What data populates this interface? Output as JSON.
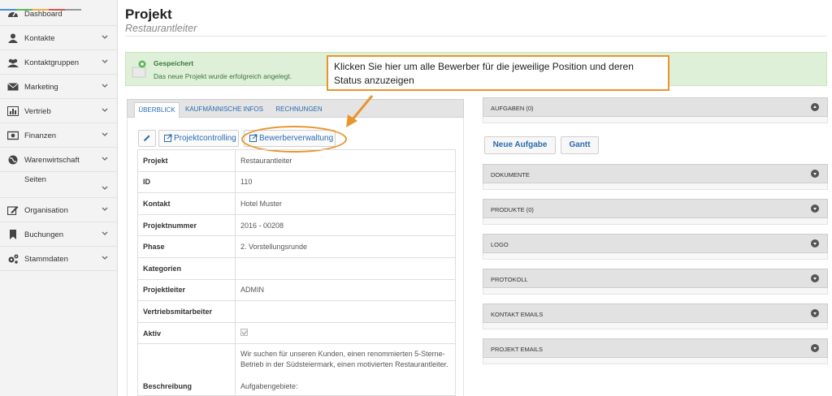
{
  "sidebar": {
    "items": [
      {
        "label": "Dashboard",
        "icon": "dashboard-icon",
        "has_chevron": false
      },
      {
        "label": "Kontakte",
        "icon": "user-icon",
        "has_chevron": true
      },
      {
        "label": "Kontaktgruppen",
        "icon": "users-icon",
        "has_chevron": true
      },
      {
        "label": "Marketing",
        "icon": "envelope-icon",
        "has_chevron": true
      },
      {
        "label": "Vertrieb",
        "icon": "bar-chart-icon",
        "has_chevron": true
      },
      {
        "label": "Finanzen",
        "icon": "money-icon",
        "has_chevron": true
      },
      {
        "label": "Warenwirtschaft",
        "icon": "globe-icon",
        "has_chevron": true
      },
      {
        "label": "Seiten",
        "icon": "",
        "has_chevron": true
      },
      {
        "label": "Organisation",
        "icon": "edit-icon",
        "has_chevron": true
      },
      {
        "label": "Buchungen",
        "icon": "bookmark-icon",
        "has_chevron": true
      },
      {
        "label": "Stammdaten",
        "icon": "cogs-icon",
        "has_chevron": true
      }
    ]
  },
  "header": {
    "title": "Projekt",
    "subtitle": "Restaurantleiter"
  },
  "alert": {
    "title": "Gespeichert",
    "message": "Das neue Projekt wurde erfolgreich angelegt."
  },
  "callout": {
    "text": "Klicken Sie hier um alle Bewerber für die jeweilige Position und deren Status anzuzeigen"
  },
  "tabs": [
    {
      "label": "ÜBERBLICK",
      "active": true
    },
    {
      "label": "KAUFMÄNNISCHE INFOS",
      "active": false
    },
    {
      "label": "RECHNUNGEN",
      "active": false
    }
  ],
  "toolbar": {
    "edit_icon": "pencil-icon",
    "projektcontrolling_label": "Projektcontrolling",
    "bewerberverwaltung_label": "Bewerberverwaltung"
  },
  "details": {
    "rows": [
      {
        "key": "Projekt",
        "value": "Restaurantleiter"
      },
      {
        "key": "ID",
        "value": "110"
      },
      {
        "key": "Kontakt",
        "value": "Hotel Muster"
      },
      {
        "key": "Projektnummer",
        "value": "2016 - 00208"
      },
      {
        "key": "Phase",
        "value": "2. Vorstellungsrunde"
      },
      {
        "key": "Kategorien",
        "value": ""
      },
      {
        "key": "Projektleiter",
        "value": "ADMIN"
      },
      {
        "key": "Vertriebsmitarbeiter",
        "value": ""
      },
      {
        "key": "Aktiv",
        "value": ""
      }
    ],
    "aktiv_checked": true,
    "beschreibung_label": "Beschreibung",
    "beschreibung_text": "Wir suchen für unseren Kunden, einen renommierten 5-Sterne-Betrieb in der Südsteiermark, einen motivierten Restaurantleiter.",
    "beschreibung_text2": "Aufgabengebiete:"
  },
  "right": {
    "aufgaben": "AUFGABEN (0)",
    "neue_aufgabe": "Neue Aufgabe",
    "gantt": "Gantt",
    "panels": [
      "DOKUMENTE",
      "PRODUKTE (0)",
      "LOGO",
      "PROTOKOLL",
      "KONTAKT EMAILS",
      "PROJEKT EMAILS"
    ]
  },
  "colors": {
    "accent_orange": "#e8952c",
    "link_blue": "#2b6cb0",
    "success_green": "#dff0d8"
  }
}
